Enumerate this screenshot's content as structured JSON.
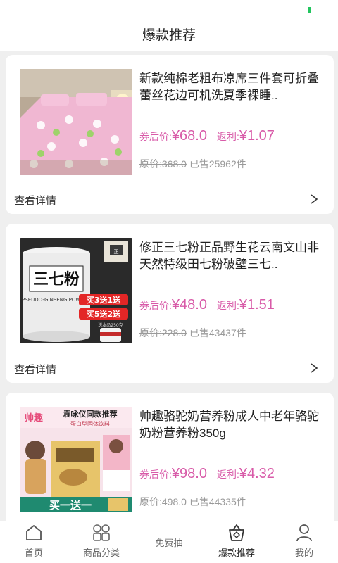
{
  "header": {
    "title": "爆款推荐"
  },
  "products": [
    {
      "name": "新款纯棉老粗布凉席三件套可折叠蕾丝花边可机洗夏季裸睡..",
      "price_label": "券后价:",
      "price": "¥68.0",
      "rebate_label": "返利:",
      "rebate": "¥1.07",
      "orig_label": "原价:",
      "orig_price": "368.0",
      "sold": "已售25962件",
      "detail_label": "查看详情"
    },
    {
      "name": "修正三七粉正品野生花云南文山非天然特级田七粉破壁三七..",
      "price_label": "券后价:",
      "price": "¥48.0",
      "rebate_label": "返利:",
      "rebate": "¥1.51",
      "orig_label": "原价:",
      "orig_price": "228.0",
      "sold": "已售43437件",
      "detail_label": "查看详情",
      "image_text": {
        "product": "三七粉",
        "subtitle": "PSEUDO-GINSENG POWDER",
        "promo1": "买3送1送",
        "promo2": "买5送2送",
        "note": "送本品250克"
      }
    },
    {
      "name": "帅趣骆驼奶营养粉成人中老年骆驼奶粉营养粉350g",
      "price_label": "券后价:",
      "price": "¥98.0",
      "rebate_label": "返利:",
      "rebate": "¥4.32",
      "orig_label": "原价:",
      "orig_price": "498.0",
      "sold": "已售44335件",
      "image_text": {
        "brand": "帅趣",
        "slogan": "袁咏仪同款推荐",
        "sub": "蛋白型固体饮料",
        "offer": "买一送一"
      }
    }
  ],
  "tabbar": {
    "items": [
      {
        "label": "首页",
        "icon": "home-icon"
      },
      {
        "label": "商品分类",
        "icon": "grid-icon"
      },
      {
        "label": "免费抽",
        "icon": "none"
      },
      {
        "label": "爆款推荐",
        "icon": "basket-icon"
      },
      {
        "label": "我的",
        "icon": "user-icon"
      }
    ],
    "active_index": 3
  },
  "colors": {
    "price": "#d85aa8",
    "background": "#efefef",
    "status_indicator": "#22c55e"
  }
}
